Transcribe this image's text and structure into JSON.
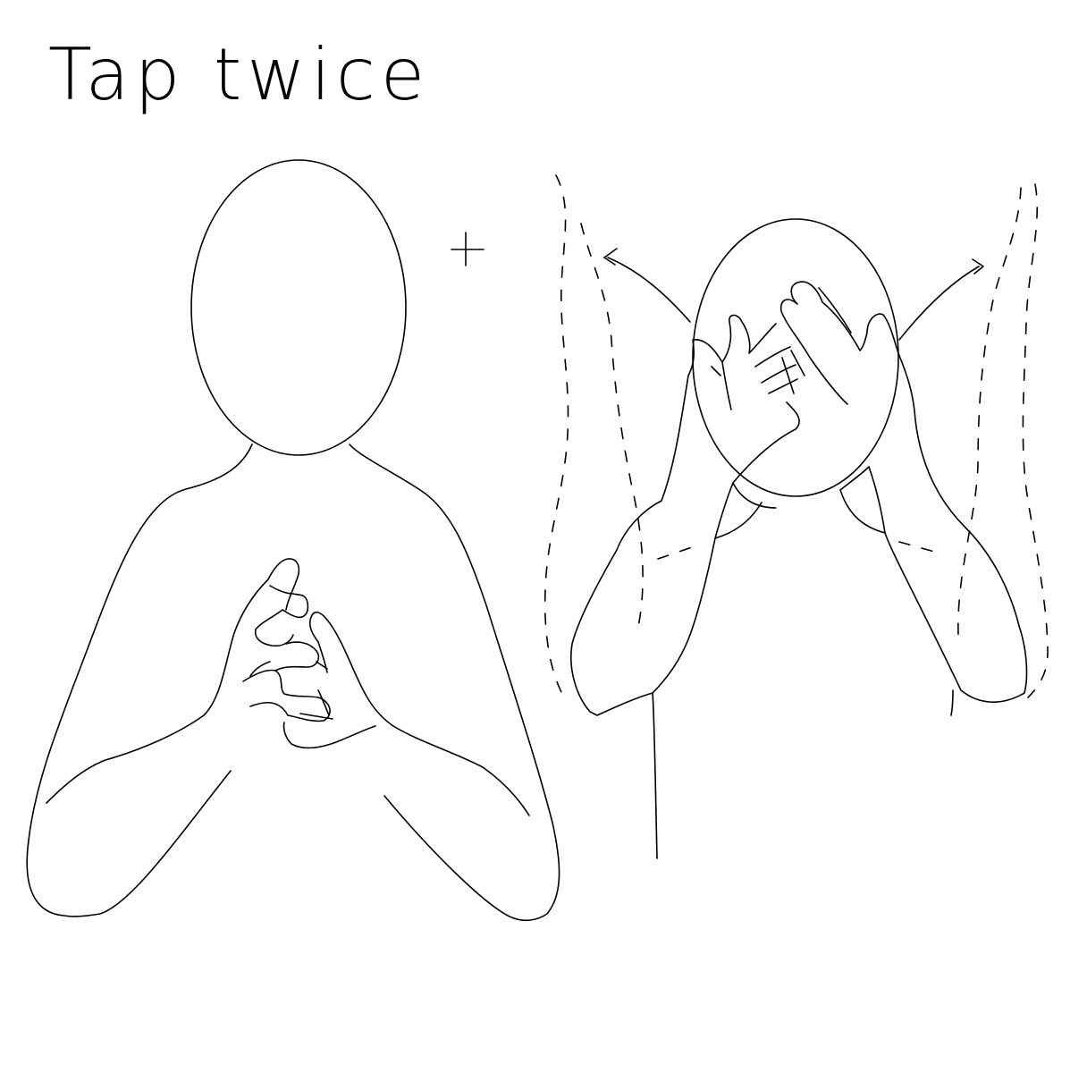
{
  "diagram": {
    "caption": "Tap twice",
    "connector_symbol": "+"
  }
}
